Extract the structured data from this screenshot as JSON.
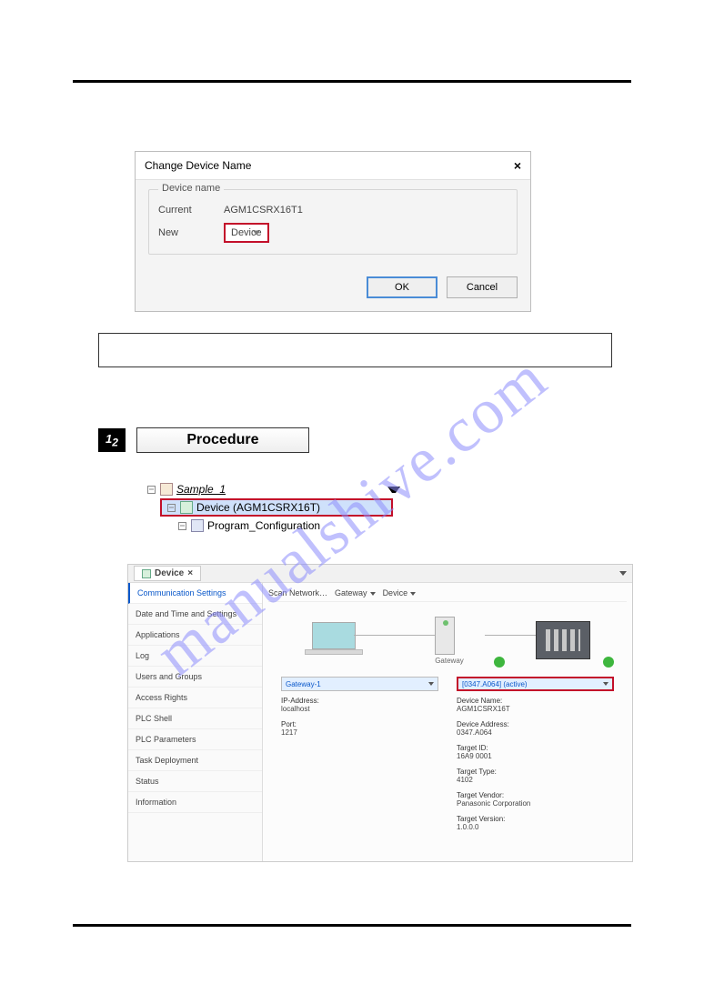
{
  "watermark": "manualshive.com",
  "dialog": {
    "title": "Change Device Name",
    "group_legend": "Device name",
    "current_label": "Current",
    "current_value": "AGM1CSRX16T1",
    "new_label": "New",
    "new_value": "Device",
    "ok": "OK",
    "cancel": "Cancel"
  },
  "procedure": {
    "num_prefix": "1",
    "num_suffix": "2",
    "title": "Procedure"
  },
  "tree": {
    "root": "Sample_1",
    "device": "Device (AGM1CSRX16T)",
    "program": "Program_Configuration"
  },
  "device_panel": {
    "tab_label": "Device",
    "side_items": [
      "Communication Settings",
      "Date and Time and Settings",
      "Applications",
      "Log",
      "Users and Groups",
      "Access Rights",
      "PLC Shell",
      "PLC Parameters",
      "Task Deployment",
      "Status",
      "Information"
    ],
    "topbar": {
      "scan": "Scan Network…",
      "gateway": "Gateway",
      "device": "Device"
    },
    "gateway_label": "Gateway",
    "gateway_select": "Gateway-1",
    "gateway_info": [
      {
        "k": "IP-Address:",
        "v": "localhost"
      },
      {
        "k": "Port:",
        "v": "1217"
      }
    ],
    "device_select": "[0347.A064] (active)",
    "device_info": [
      {
        "k": "Device Name:",
        "v": "AGM1CSRX16T"
      },
      {
        "k": "Device Address:",
        "v": "0347.A064"
      },
      {
        "k": "Target ID:",
        "v": "16A9 0001"
      },
      {
        "k": "Target Type:",
        "v": "4102"
      },
      {
        "k": "Target Vendor:",
        "v": "Panasonic Corporation"
      },
      {
        "k": "Target Version:",
        "v": "1.0.0.0"
      }
    ]
  }
}
